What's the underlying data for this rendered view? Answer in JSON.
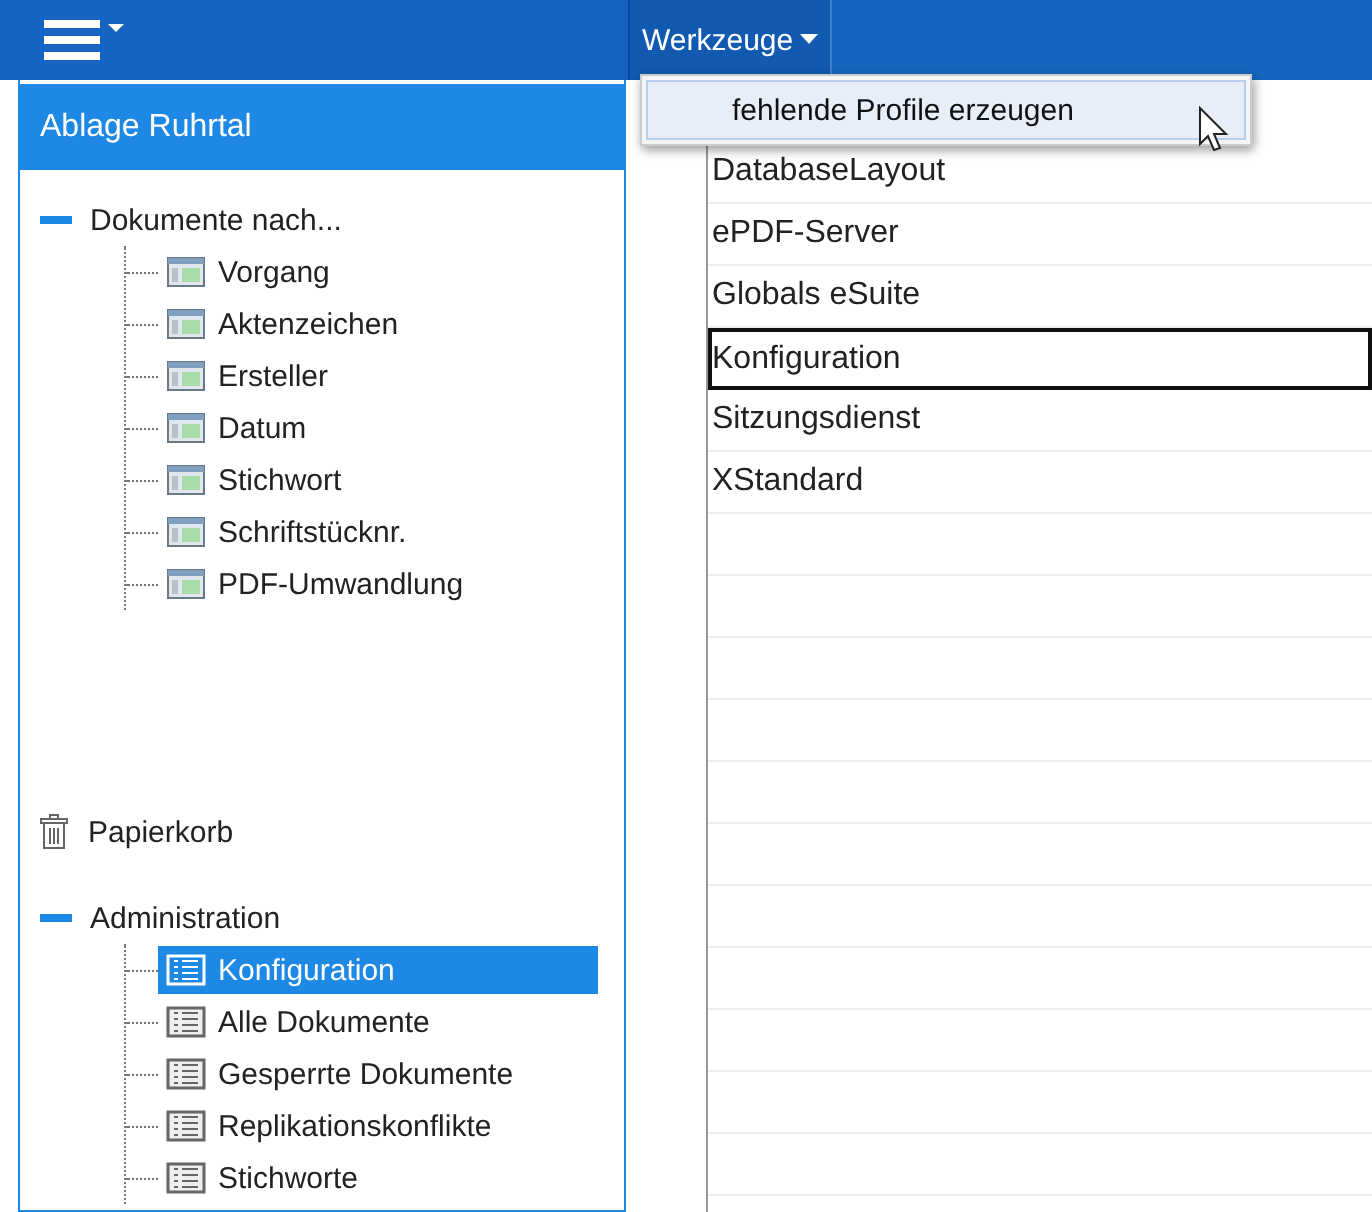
{
  "top_bar": {
    "menu": {
      "label": "Werkzeuge",
      "expanded": true,
      "items": [
        {
          "label": "fehlende Profile erzeugen",
          "selected": true
        }
      ]
    }
  },
  "sidebar": {
    "title": "Ablage Ruhrtal",
    "sections": [
      {
        "kind": "group",
        "label": "Dokumente nach...",
        "expanded": true,
        "children": [
          {
            "kind": "view",
            "label": "Vorgang",
            "selected": false
          },
          {
            "kind": "view",
            "label": "Aktenzeichen",
            "selected": false
          },
          {
            "kind": "view",
            "label": "Ersteller",
            "selected": false
          },
          {
            "kind": "view",
            "label": "Datum",
            "selected": false
          },
          {
            "kind": "view",
            "label": "Stichwort",
            "selected": false
          },
          {
            "kind": "view",
            "label": "Schriftstücknr.",
            "selected": false
          },
          {
            "kind": "view",
            "label": "PDF-Umwandlung",
            "selected": false
          }
        ]
      },
      {
        "kind": "trash",
        "label": "Papierkorb"
      },
      {
        "kind": "group",
        "label": "Administration",
        "expanded": true,
        "children": [
          {
            "kind": "list",
            "label": "Konfiguration",
            "selected": true
          },
          {
            "kind": "list",
            "label": "Alle Dokumente",
            "selected": false
          },
          {
            "kind": "list",
            "label": "Gesperrte Dokumente",
            "selected": false
          },
          {
            "kind": "list",
            "label": "Replikationskonflikte",
            "selected": false
          },
          {
            "kind": "list",
            "label": "Stichworte",
            "selected": false
          }
        ]
      }
    ]
  },
  "table": {
    "rows": [
      {
        "name": "DatabaseLayout",
        "focused": false
      },
      {
        "name": "ePDF-Server",
        "focused": false
      },
      {
        "name": "Globals eSuite",
        "focused": false
      },
      {
        "name": "Konfiguration",
        "focused": true
      },
      {
        "name": "Sitzungsdienst",
        "focused": false
      },
      {
        "name": "XStandard",
        "focused": false
      }
    ]
  }
}
